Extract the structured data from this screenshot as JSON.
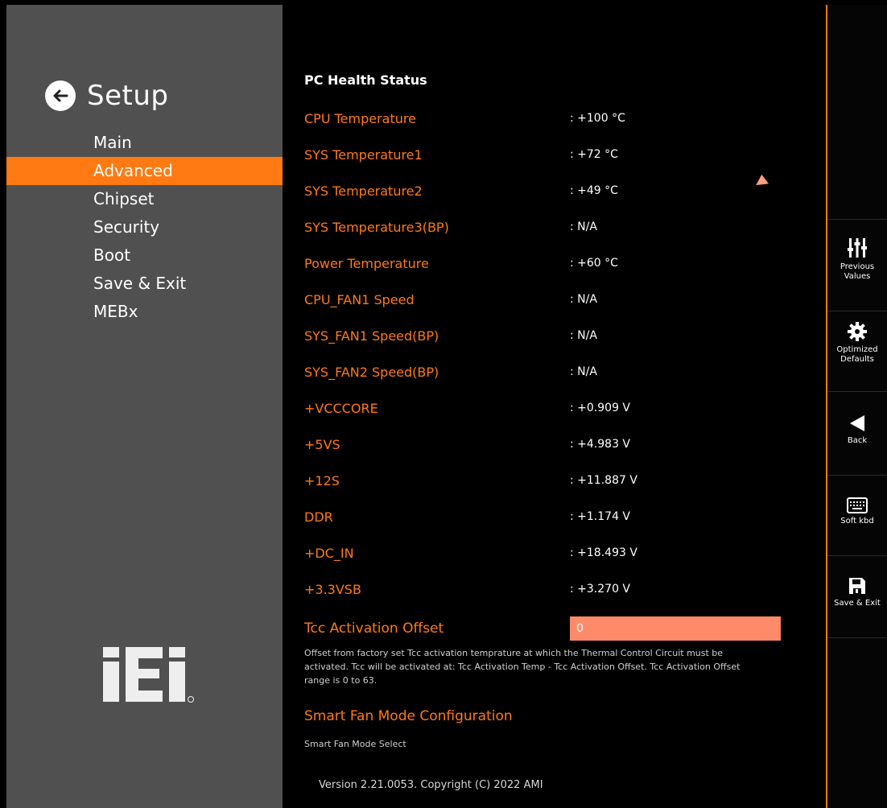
{
  "sidebar": {
    "title": "Setup",
    "menu": [
      "Main",
      "Advanced",
      "Chipset",
      "Security",
      "Boot",
      "Save & Exit",
      "MEBx"
    ],
    "active": "Advanced",
    "logo_text": "iEi"
  },
  "main": {
    "section_title": "PC Health Status",
    "readings": [
      {
        "label": "CPU Temperature",
        "value": ": +100 °C"
      },
      {
        "label": "SYS Temperature1",
        "value": ": +72 °C"
      },
      {
        "label": "SYS Temperature2",
        "value": ": +49 °C"
      },
      {
        "label": "SYS Temperature3(BP)",
        "value": ": N/A"
      },
      {
        "label": "Power Temperature",
        "value": ": +60 °C"
      },
      {
        "label": "CPU_FAN1 Speed",
        "value": ": N/A"
      },
      {
        "label": "SYS_FAN1 Speed(BP)",
        "value": ": N/A"
      },
      {
        "label": "SYS_FAN2 Speed(BP)",
        "value": ": N/A"
      },
      {
        "label": "+VCCCORE",
        "value": ": +0.909 V"
      },
      {
        "label": "+5VS",
        "value": ": +4.983 V"
      },
      {
        "label": "+12S",
        "value": ": +11.887 V"
      },
      {
        "label": "DDR",
        "value": ": +1.174 V"
      },
      {
        "label": "+DC_IN",
        "value": ": +18.493 V"
      },
      {
        "label": "+3.3VSB",
        "value": ": +3.270 V"
      }
    ],
    "tcc": {
      "label": "Tcc Activation Offset",
      "value": "0",
      "help": "Offset from factory set Tcc activation temprature at which the Thermal Control Circuit must be activated. Tcc will be activated at: Tcc Activation Temp - Tcc Activation Offset. Tcc Activation Offset range is 0 to 63."
    },
    "smart_fan": {
      "title": "Smart Fan Mode Configuration",
      "help": "Smart Fan Mode Select"
    },
    "version": "Version 2.21.0053. Copyright (C) 2022 AMI"
  },
  "toolbar": {
    "previous_values": "Previous Values",
    "optimized_defaults": "Optimized Defaults",
    "back": "Back",
    "soft_kbd": "Soft kbd",
    "save_exit": "Save & Exit"
  },
  "colors": {
    "accent": "#ff7a12",
    "input_bg": "#ff8a6a",
    "sidebar_bg": "#505050",
    "main_bg": "#000000"
  }
}
